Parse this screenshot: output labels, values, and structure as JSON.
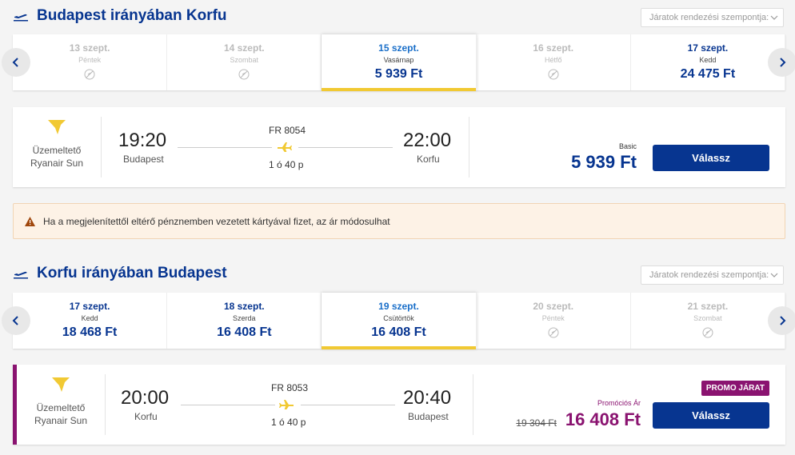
{
  "outbound": {
    "title": "Budapest irányában Korfu",
    "sort_placeholder": "Járatok rendezési szempontja:",
    "dates": [
      {
        "date": "13 szept.",
        "day": "Péntek",
        "price": "",
        "disabled": true
      },
      {
        "date": "14 szept.",
        "day": "Szombat",
        "price": "",
        "disabled": true
      },
      {
        "date": "15 szept.",
        "day": "Vasárnap",
        "price": "5 939 Ft",
        "selected": true
      },
      {
        "date": "16 szept.",
        "day": "Hétfő",
        "price": "",
        "disabled": true
      },
      {
        "date": "17 szept.",
        "day": "Kedd",
        "price": "24 475 Ft"
      }
    ],
    "flight": {
      "operator_label": "Üzemeltető",
      "operator_name": "Ryanair Sun",
      "dep_time": "19:20",
      "dep_city": "Budapest",
      "flight_no": "FR 8054",
      "duration": "1 ó 40 p",
      "arr_time": "22:00",
      "arr_city": "Korfu",
      "fare_label": "Basic",
      "price": "5 939 Ft",
      "button": "Válassz"
    }
  },
  "warning_text": "Ha a megjelenítettől eltérő pénznemben vezetett kártyával fizet, az ár módosulhat",
  "inbound": {
    "title": "Korfu irányában Budapest",
    "sort_placeholder": "Járatok rendezési szempontja:",
    "dates": [
      {
        "date": "17 szept.",
        "day": "Kedd",
        "price": "18 468 Ft"
      },
      {
        "date": "18 szept.",
        "day": "Szerda",
        "price": "16 408 Ft"
      },
      {
        "date": "19 szept.",
        "day": "Csütörtök",
        "price": "16 408 Ft",
        "selected": true
      },
      {
        "date": "20 szept.",
        "day": "Péntek",
        "price": "",
        "disabled": true
      },
      {
        "date": "21 szept.",
        "day": "Szombat",
        "price": "",
        "disabled": true
      }
    ],
    "flight": {
      "operator_label": "Üzemeltető",
      "operator_name": "Ryanair Sun",
      "dep_time": "20:00",
      "dep_city": "Korfu",
      "flight_no": "FR 8053",
      "duration": "1 ó 40 p",
      "arr_time": "20:40",
      "arr_city": "Budapest",
      "promo_badge": "PROMO JÁRAT",
      "fare_label": "Promóciós Ár",
      "old_price": "19 304 Ft",
      "price": "16 408 Ft",
      "button": "Válassz"
    }
  },
  "colors": {
    "brand": "#073590",
    "accent": "#f1c933",
    "promo": "#8a1370"
  },
  "icons": [
    "plane-icon",
    "no-flight-icon",
    "chevron-left-icon",
    "chevron-right-icon",
    "ryanair-logo-icon",
    "warning-icon",
    "chevron-down-icon"
  ]
}
